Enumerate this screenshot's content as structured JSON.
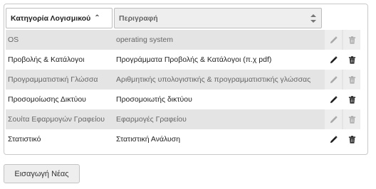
{
  "table": {
    "columns": {
      "category": {
        "label": "Κατηγορία Λογισμικού",
        "sort_arrow": "⌃"
      },
      "description": {
        "label": "Περιγραφή"
      }
    },
    "rows": [
      {
        "category": "OS",
        "description": "operating system",
        "disabled": true
      },
      {
        "category": "Προβολής & Κατάλογοι",
        "description": "Προγράμματα Προβολής & Κατάλογοι (π.χ pdf)",
        "disabled": false
      },
      {
        "category": "Προγραμματιστική Γλώσσα",
        "description": "Αριθμητικής υπολογιστικής & προγραμματιστικής γλώσσας",
        "disabled": true
      },
      {
        "category": "Προσομοίωσης Δικτύου",
        "description": "Προσομοιωτής δικτύου",
        "disabled": false
      },
      {
        "category": "Σουίτα Εφαρμογών Γραφείου",
        "description": "Εφαρμογές Γραφείου",
        "disabled": true
      },
      {
        "category": "Στατιστικό",
        "description": "Στατιστική Ανάλυση",
        "disabled": false
      }
    ],
    "icons": {
      "edit": "pencil-icon",
      "delete": "trash-icon"
    },
    "colors": {
      "active_icon": "#1a1a1a",
      "disabled_icon": "#a8a8a8",
      "disabled_row": "#e4e4e4"
    }
  },
  "actions": {
    "new_label": "Εισαγωγή Νέας"
  }
}
